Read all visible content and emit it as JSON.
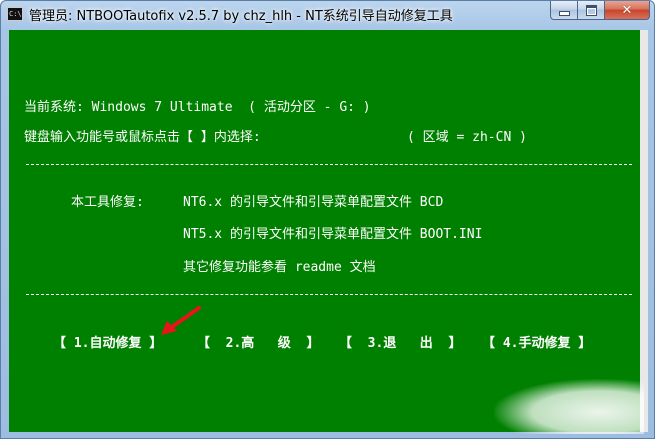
{
  "window": {
    "icon_text": "C:\\",
    "title": "管理员:  NTBOOTautofix v2.5.7 by chz_hlh - NT系统引导自动修复工具",
    "close_symbol": "✕"
  },
  "console": {
    "current_system": "当前系统: Windows 7 Ultimate  ( 活动分区 - G: )",
    "prompt": "键盘输入功能号或鼠标点击【 】内选择:",
    "region": "( 区域 = zh-CN )",
    "repair_label": "本工具修复:",
    "repair_line1": "NT6.x 的引导文件和引导菜单配置文件 BCD",
    "repair_line2": "NT5.x 的引导文件和引导菜单配置文件 BOOT.INI",
    "repair_line3": "其它修复功能参看 readme 文档"
  },
  "menu": {
    "auto_repair": "【 1.自动修复 】",
    "advanced": "【  2.高   级  】",
    "exit": "【  3.退   出  】",
    "manual_repair": "【 4.手动修复 】"
  },
  "colors": {
    "console_bg": "#008000",
    "console_text": "#ffffff",
    "arrow": "#e8141a"
  },
  "icons": {
    "arrow": "arrow-icon",
    "app": "cmd-icon"
  }
}
